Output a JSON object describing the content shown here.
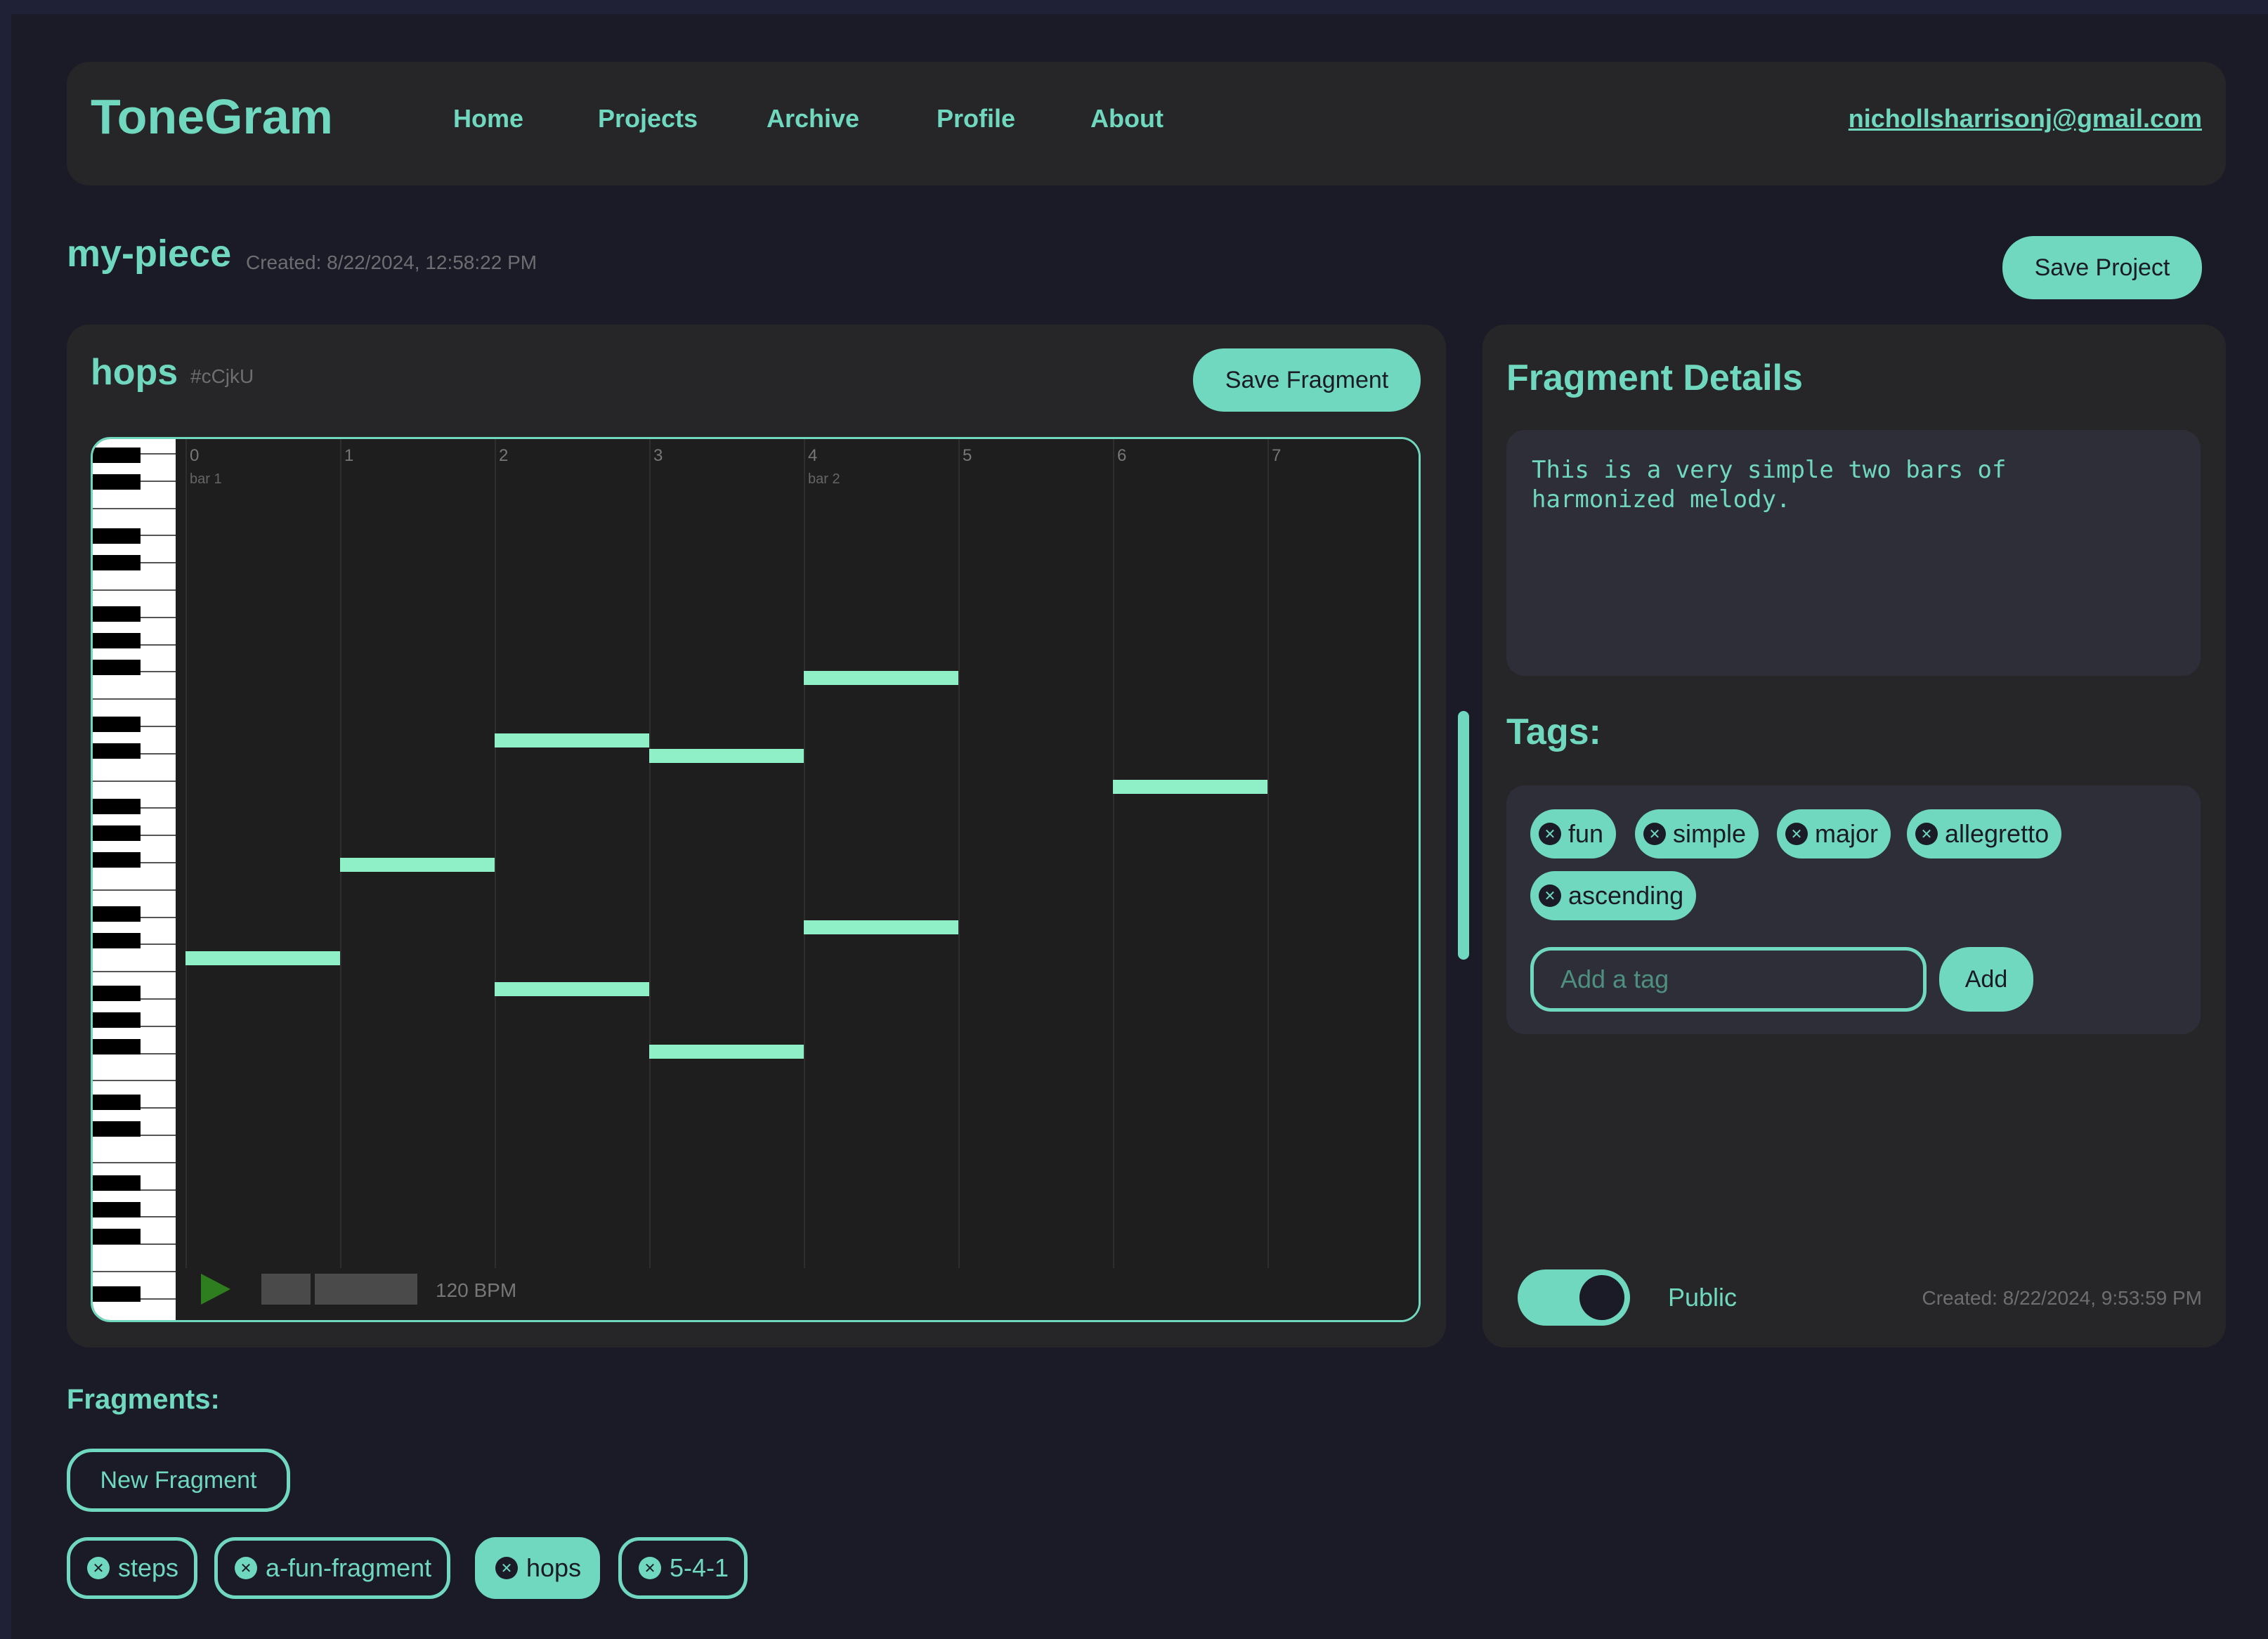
{
  "app": {
    "brand": "ToneGram",
    "accent_color": "#6fd8be"
  },
  "nav": {
    "links": [
      "Home",
      "Projects",
      "Archive",
      "Profile",
      "About"
    ],
    "user_email": "nichollsharrisonj@gmail.com"
  },
  "project": {
    "name": "my-piece",
    "created": "Created: 8/22/2024, 12:58:22 PM",
    "save_label": "Save Project"
  },
  "fragment": {
    "name": "hops",
    "hash": "#cCjkU",
    "save_label": "Save Fragment",
    "beats": [
      "0",
      "1",
      "2",
      "3",
      "4",
      "5",
      "6",
      "7"
    ],
    "bars": [
      "bar 1",
      "bar 2"
    ],
    "tempo": "120 BPM",
    "notes": [
      {
        "beat": 0,
        "length": 1,
        "row": 16
      },
      {
        "beat": 1,
        "length": 1,
        "row": 13
      },
      {
        "beat": 2,
        "length": 1,
        "row": 9
      },
      {
        "beat": 2,
        "length": 1,
        "row": 17
      },
      {
        "beat": 3,
        "length": 1,
        "row": 9.5
      },
      {
        "beat": 3,
        "length": 1,
        "row": 19
      },
      {
        "beat": 4,
        "length": 1,
        "row": 7
      },
      {
        "beat": 4,
        "length": 1,
        "row": 15
      },
      {
        "beat": 6,
        "length": 1,
        "row": 10.5
      }
    ]
  },
  "details": {
    "title": "Fragment Details",
    "description": "This is a very simple two bars of\nharmonized melody.",
    "tags_label": "Tags:",
    "tags": [
      "fun",
      "simple",
      "major",
      "allegretto",
      "ascending"
    ],
    "tag_placeholder": "Add a tag",
    "add_label": "Add",
    "visibility": "Public",
    "is_public": true,
    "created": "Created: 8/22/2024, 9:53:59 PM"
  },
  "fragments": {
    "label": "Fragments:",
    "new_label": "New Fragment",
    "items": [
      "steps",
      "a-fun-fragment",
      "hops",
      "5-4-1"
    ],
    "active": "hops"
  }
}
